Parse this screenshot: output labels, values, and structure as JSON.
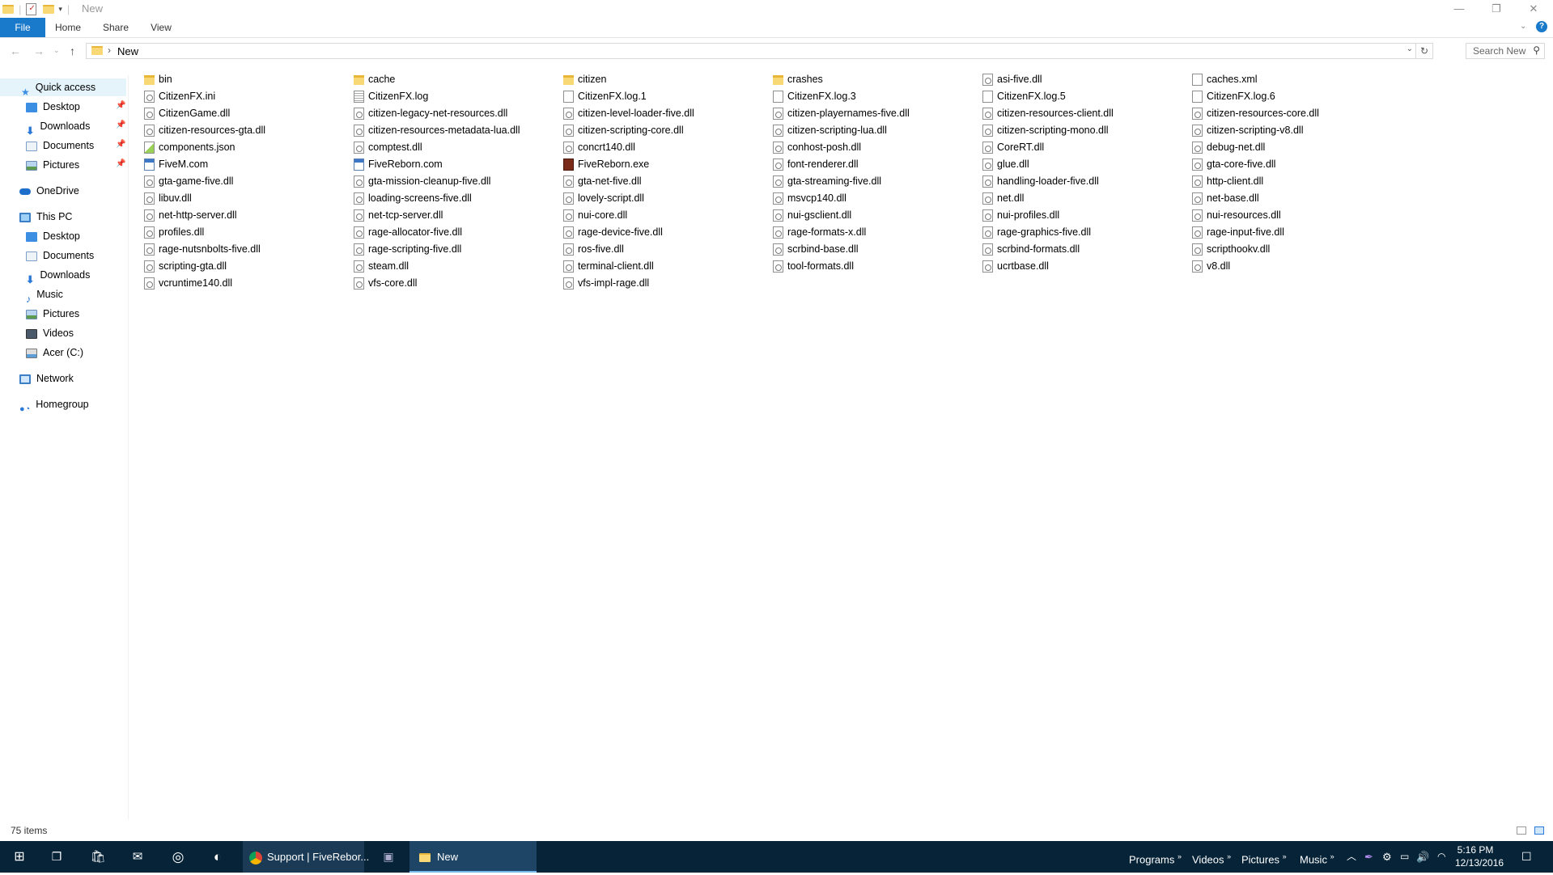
{
  "window": {
    "title": "New",
    "ribbon_tabs": [
      "File",
      "Home",
      "Share",
      "View"
    ]
  },
  "address": {
    "path_segment": "New",
    "search_placeholder": "Search New"
  },
  "nav_pane": {
    "quick_access": "Quick access",
    "quick_items": [
      "Desktop",
      "Downloads",
      "Documents",
      "Pictures"
    ],
    "onedrive": "OneDrive",
    "this_pc": "This PC",
    "pc_items": [
      "Desktop",
      "Documents",
      "Downloads",
      "Music",
      "Pictures",
      "Videos",
      "Acer (C:)"
    ],
    "network": "Network",
    "homegroup": "Homegroup"
  },
  "files": [
    {
      "name": "bin",
      "type": "folder"
    },
    {
      "name": "cache",
      "type": "folder"
    },
    {
      "name": "citizen",
      "type": "folder"
    },
    {
      "name": "crashes",
      "type": "folder"
    },
    {
      "name": "asi-five.dll",
      "type": "dll"
    },
    {
      "name": "caches.xml",
      "type": "xml"
    },
    {
      "name": "CitizenFX.ini",
      "type": "dll"
    },
    {
      "name": "CitizenFX.log",
      "type": "text"
    },
    {
      "name": "CitizenFX.log.1",
      "type": "file"
    },
    {
      "name": "CitizenFX.log.3",
      "type": "file"
    },
    {
      "name": "CitizenFX.log.5",
      "type": "file"
    },
    {
      "name": "CitizenFX.log.6",
      "type": "file"
    },
    {
      "name": "CitizenGame.dll",
      "type": "dll"
    },
    {
      "name": "citizen-legacy-net-resources.dll",
      "type": "dll"
    },
    {
      "name": "citizen-level-loader-five.dll",
      "type": "dll"
    },
    {
      "name": "citizen-playernames-five.dll",
      "type": "dll"
    },
    {
      "name": "citizen-resources-client.dll",
      "type": "dll"
    },
    {
      "name": "citizen-resources-core.dll",
      "type": "dll"
    },
    {
      "name": "citizen-resources-gta.dll",
      "type": "dll"
    },
    {
      "name": "citizen-resources-metadata-lua.dll",
      "type": "dll"
    },
    {
      "name": "citizen-scripting-core.dll",
      "type": "dll"
    },
    {
      "name": "citizen-scripting-lua.dll",
      "type": "dll"
    },
    {
      "name": "citizen-scripting-mono.dll",
      "type": "dll"
    },
    {
      "name": "citizen-scripting-v8.dll",
      "type": "dll"
    },
    {
      "name": "components.json",
      "type": "json"
    },
    {
      "name": "comptest.dll",
      "type": "dll"
    },
    {
      "name": "concrt140.dll",
      "type": "dll"
    },
    {
      "name": "conhost-posh.dll",
      "type": "dll"
    },
    {
      "name": "CoreRT.dll",
      "type": "dll"
    },
    {
      "name": "debug-net.dll",
      "type": "dll"
    },
    {
      "name": "FiveM.com",
      "type": "app"
    },
    {
      "name": "FiveReborn.com",
      "type": "app"
    },
    {
      "name": "FiveReborn.exe",
      "type": "exe"
    },
    {
      "name": "font-renderer.dll",
      "type": "dll"
    },
    {
      "name": "glue.dll",
      "type": "dll"
    },
    {
      "name": "gta-core-five.dll",
      "type": "dll"
    },
    {
      "name": "gta-game-five.dll",
      "type": "dll"
    },
    {
      "name": "gta-mission-cleanup-five.dll",
      "type": "dll"
    },
    {
      "name": "gta-net-five.dll",
      "type": "dll"
    },
    {
      "name": "gta-streaming-five.dll",
      "type": "dll"
    },
    {
      "name": "handling-loader-five.dll",
      "type": "dll"
    },
    {
      "name": "http-client.dll",
      "type": "dll"
    },
    {
      "name": "libuv.dll",
      "type": "dll"
    },
    {
      "name": "loading-screens-five.dll",
      "type": "dll"
    },
    {
      "name": "lovely-script.dll",
      "type": "dll"
    },
    {
      "name": "msvcp140.dll",
      "type": "dll"
    },
    {
      "name": "net.dll",
      "type": "dll"
    },
    {
      "name": "net-base.dll",
      "type": "dll"
    },
    {
      "name": "net-http-server.dll",
      "type": "dll"
    },
    {
      "name": "net-tcp-server.dll",
      "type": "dll"
    },
    {
      "name": "nui-core.dll",
      "type": "dll"
    },
    {
      "name": "nui-gsclient.dll",
      "type": "dll"
    },
    {
      "name": "nui-profiles.dll",
      "type": "dll"
    },
    {
      "name": "nui-resources.dll",
      "type": "dll"
    },
    {
      "name": "profiles.dll",
      "type": "dll"
    },
    {
      "name": "rage-allocator-five.dll",
      "type": "dll"
    },
    {
      "name": "rage-device-five.dll",
      "type": "dll"
    },
    {
      "name": "rage-formats-x.dll",
      "type": "dll"
    },
    {
      "name": "rage-graphics-five.dll",
      "type": "dll"
    },
    {
      "name": "rage-input-five.dll",
      "type": "dll"
    },
    {
      "name": "rage-nutsnbolts-five.dll",
      "type": "dll"
    },
    {
      "name": "rage-scripting-five.dll",
      "type": "dll"
    },
    {
      "name": "ros-five.dll",
      "type": "dll"
    },
    {
      "name": "scrbind-base.dll",
      "type": "dll"
    },
    {
      "name": "scrbind-formats.dll",
      "type": "dll"
    },
    {
      "name": "scripthookv.dll",
      "type": "dll"
    },
    {
      "name": "scripting-gta.dll",
      "type": "dll"
    },
    {
      "name": "steam.dll",
      "type": "dll"
    },
    {
      "name": "terminal-client.dll",
      "type": "dll"
    },
    {
      "name": "tool-formats.dll",
      "type": "dll"
    },
    {
      "name": "ucrtbase.dll",
      "type": "dll"
    },
    {
      "name": "v8.dll",
      "type": "dll"
    },
    {
      "name": "vcruntime140.dll",
      "type": "dll"
    },
    {
      "name": "vfs-core.dll",
      "type": "dll"
    },
    {
      "name": "vfs-impl-rage.dll",
      "type": "dll"
    }
  ],
  "status": {
    "item_count": "75 items"
  },
  "taskbar": {
    "chrome_label": "Support | FiveRebor...",
    "explorer_label": "New",
    "toolbars": [
      "Programs",
      "Videos",
      "Pictures",
      "Music"
    ],
    "time": "5:16 PM",
    "date": "12/13/2016"
  },
  "colors": {
    "accent": "#1979ca",
    "taskbar": "#062338",
    "folder": "#f8d775"
  }
}
